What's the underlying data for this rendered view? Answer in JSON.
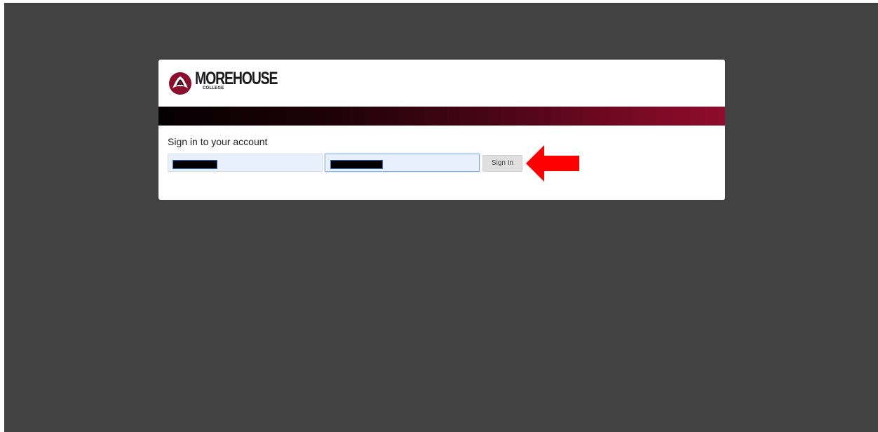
{
  "brand": {
    "name": "MOREHOUSE",
    "subname": "COLLEGE",
    "colors": {
      "maroon": "#8d0d2c",
      "dark": "#050002"
    }
  },
  "login": {
    "heading": "Sign in to your account",
    "username_value": "",
    "password_value": "",
    "sign_in_label": "Sign In"
  },
  "annotation": {
    "arrow_color": "#ff0000"
  },
  "icons": {
    "logo": "morehouse-tiger-emblem-icon",
    "arrow": "left-arrow-icon"
  },
  "background_color": "#424242"
}
